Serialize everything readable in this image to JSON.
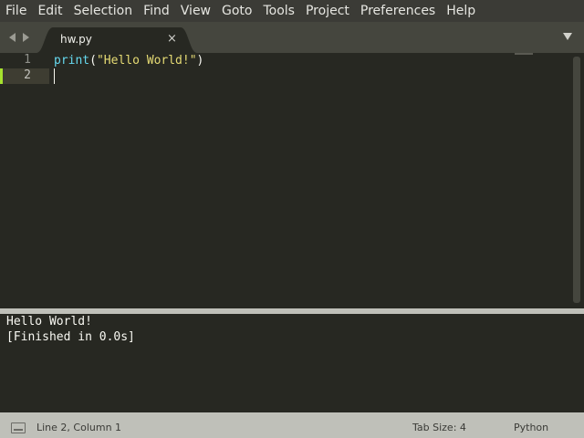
{
  "menu": {
    "items": [
      {
        "label": "File"
      },
      {
        "label": "Edit"
      },
      {
        "label": "Selection"
      },
      {
        "label": "Find"
      },
      {
        "label": "View"
      },
      {
        "label": "Goto"
      },
      {
        "label": "Tools"
      },
      {
        "label": "Project"
      },
      {
        "label": "Preferences"
      },
      {
        "label": "Help"
      }
    ]
  },
  "tabs": [
    {
      "label": "hw.py",
      "close_icon": "×",
      "active": true
    }
  ],
  "editor": {
    "line_numbers": [
      "1",
      "2"
    ],
    "code": {
      "func": "print",
      "open_paren": "(",
      "string": "\"Hello World!\"",
      "close_paren": ")"
    },
    "active_line": 2
  },
  "output": {
    "lines": [
      "Hello World!",
      "[Finished in 0.0s]"
    ]
  },
  "status": {
    "position": "Line 2, Column 1",
    "tab_size": "Tab Size: 4",
    "syntax": "Python"
  },
  "colors": {
    "background": "#272822",
    "keyword_func": "#66d9ef",
    "string": "#e6db74",
    "modified_marker": "#a6e22e"
  }
}
